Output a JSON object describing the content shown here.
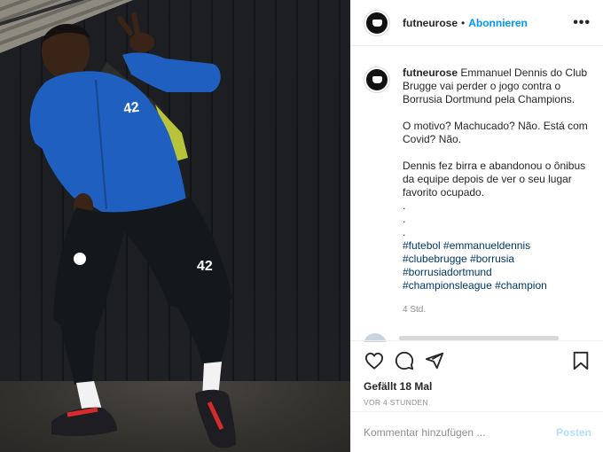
{
  "post": {
    "username": "futneurose",
    "follow_label": "Abonnieren",
    "header_separator": "•",
    "more_label": "•••",
    "caption": {
      "username": "futneurose",
      "lines": [
        "Emmanuel Dennis do Club Brugge vai perder o jogo contra o Borrusia Dortmund pela Champions.",
        "",
        "O motivo? Machucado? Não. Está com Covid? Não.",
        "",
        "Dennis fez birra e abandonou o ônibus da equipe depois de ver o seu lugar favorito ocupado.",
        ".",
        ".",
        "."
      ],
      "hashtags_lines": [
        [
          "#futebol",
          "#emmanueldennis"
        ],
        [
          "#clubebrugge",
          "#borrusia"
        ],
        [
          "#borrusiadortmund"
        ],
        [
          "#championsleague",
          "#champion"
        ]
      ],
      "time": "4 Std."
    },
    "likes": "Gefällt 18 Mal",
    "posted_ago": "VOR 4 STUNDEN",
    "comment_placeholder": "Kommentar hinzufügen ...",
    "post_button": "Posten"
  },
  "photo": {
    "jersey_number": "42",
    "colors": {
      "jersey": "#1f5fbf",
      "shorts": "#14171c",
      "sock": "#f2f2f2",
      "shoe_lace": "#d62b2b"
    }
  },
  "colors": {
    "accent": "#0095f6",
    "hashtag": "#00376b",
    "muted": "#8e8e8e"
  },
  "icons": {
    "like": "heart-icon",
    "comment": "comment-icon",
    "share": "paper-plane-icon",
    "save": "bookmark-icon",
    "more": "more-dots-icon"
  }
}
